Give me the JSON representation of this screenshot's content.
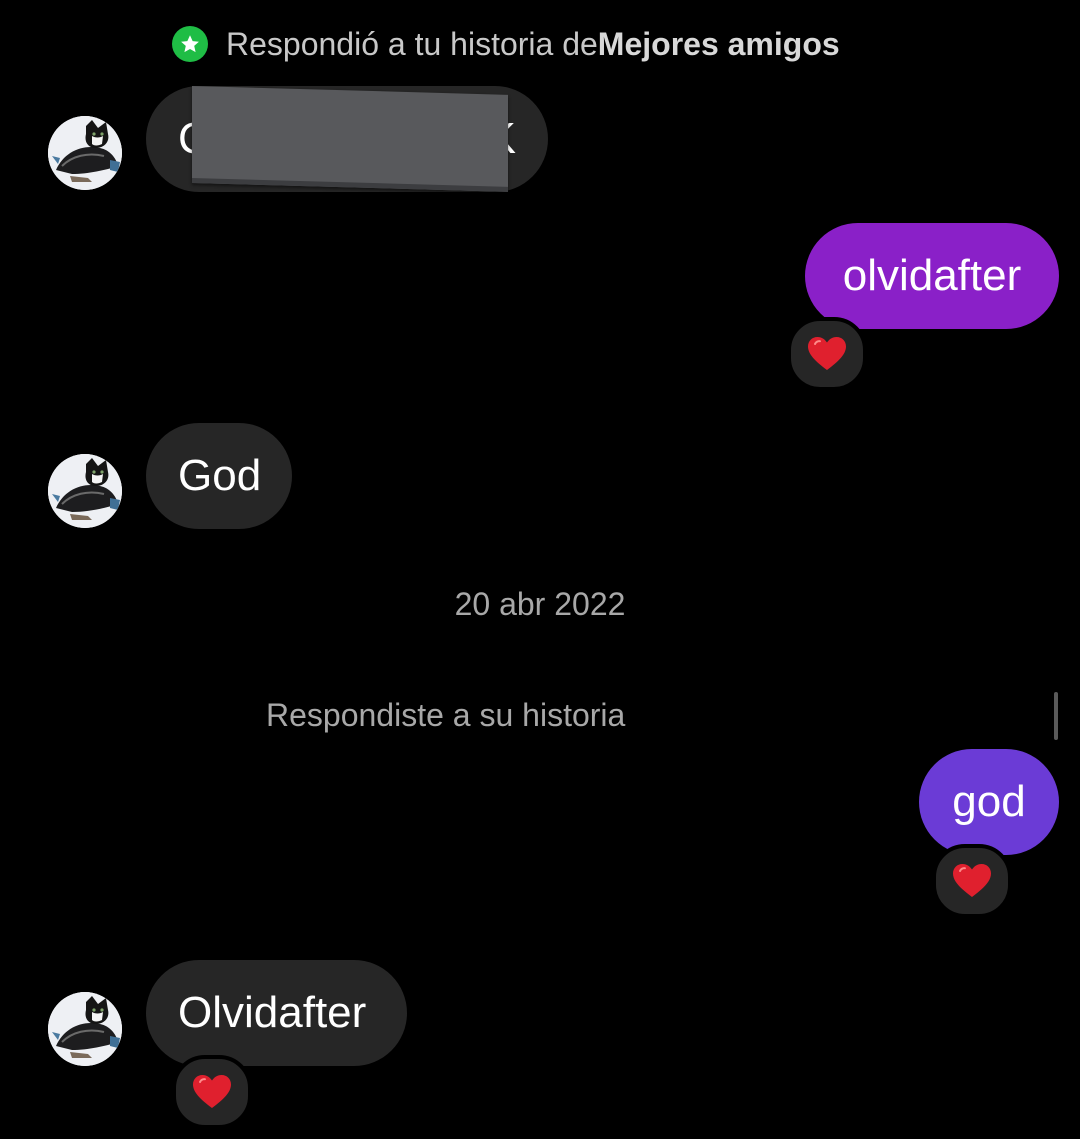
{
  "story_reply": {
    "prefix": "Respondió a tu historia de ",
    "list_name": "Mejores amigos",
    "badge_icon": "star-icon",
    "badge_color": "#1fbd45"
  },
  "messages": [
    {
      "sender": "them",
      "text_start": "C",
      "text_end": "K",
      "redacted": true
    },
    {
      "sender": "me",
      "text": "olvidafter",
      "bubble_color": "#8a20c8",
      "reaction": "red-heart-icon"
    },
    {
      "sender": "them",
      "text": "God"
    },
    {
      "sender": "me",
      "text": "god",
      "bubble_color": "#6b3bd6",
      "reaction": "red-heart-icon"
    },
    {
      "sender": "them",
      "text": "Olvidafter",
      "reaction": "red-heart-icon"
    }
  ],
  "date_separator": "20 abr 2022",
  "reply_note": "Respondiste a su historia",
  "colors": {
    "background": "#000000",
    "incoming_bubble": "#262626",
    "heart": "#e0202e"
  }
}
